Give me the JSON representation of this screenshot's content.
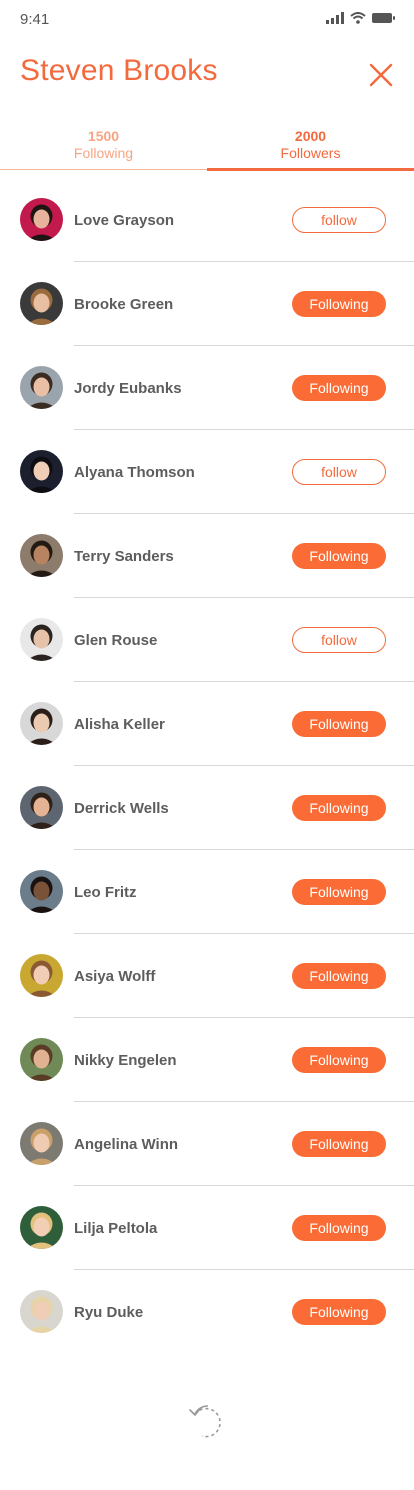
{
  "status_bar": {
    "time": "9:41"
  },
  "header": {
    "title": "Steven Brooks"
  },
  "tabs": {
    "following": {
      "count": "1500",
      "label": "Following"
    },
    "followers": {
      "count": "2000",
      "label": "Followers"
    }
  },
  "colors": {
    "accent": "#f26a3d",
    "button_fill": "#fa6b36",
    "separator": "#d9d9d9"
  },
  "users": [
    {
      "name": "Love Grayson",
      "button": "follow",
      "state": "follow",
      "avatar_bg": "#c21a4c",
      "face": "#e7b39c",
      "hair": "#1e1414"
    },
    {
      "name": "Brooke Green",
      "button": "Following",
      "state": "following",
      "avatar_bg": "#3a3a3a",
      "face": "#e8bfa2",
      "hair": "#9a6b3c"
    },
    {
      "name": "Jordy Eubanks",
      "button": "Following",
      "state": "following",
      "avatar_bg": "#9aa4ad",
      "face": "#e9c0a6",
      "hair": "#3a2c22"
    },
    {
      "name": "Alyana Thomson",
      "button": "follow",
      "state": "follow",
      "avatar_bg": "#1b1f2e",
      "face": "#f0cdb7",
      "hair": "#0e0d12"
    },
    {
      "name": "Terry Sanders",
      "button": "Following",
      "state": "following",
      "avatar_bg": "#8d7c6c",
      "face": "#b88360",
      "hair": "#231a14"
    },
    {
      "name": "Glen Rouse",
      "button": "follow",
      "state": "follow",
      "avatar_bg": "#e8e8e8",
      "face": "#e5c2a8",
      "hair": "#2a2320"
    },
    {
      "name": "Alisha Keller",
      "button": "Following",
      "state": "following",
      "avatar_bg": "#d8d8d8",
      "face": "#eccab2",
      "hair": "#2b1d17"
    },
    {
      "name": "Derrick Wells",
      "button": "Following",
      "state": "following",
      "avatar_bg": "#5d6670",
      "face": "#e3b393",
      "hair": "#2f2119"
    },
    {
      "name": "Leo Fritz",
      "button": "Following",
      "state": "following",
      "avatar_bg": "#6b7c8a",
      "face": "#7a5238",
      "hair": "#1a1210"
    },
    {
      "name": "Asiya Wolff",
      "button": "Following",
      "state": "following",
      "avatar_bg": "#c9a832",
      "face": "#f1cdb6",
      "hair": "#8a5a34"
    },
    {
      "name": "Nikky Engelen",
      "button": "Following",
      "state": "following",
      "avatar_bg": "#6f8a57",
      "face": "#e1b292",
      "hair": "#5a3b25"
    },
    {
      "name": "Angelina Winn",
      "button": "Following",
      "state": "following",
      "avatar_bg": "#7d7a72",
      "face": "#efcbb2",
      "hair": "#c9a06a"
    },
    {
      "name": "Lilja Peltola",
      "button": "Following",
      "state": "following",
      "avatar_bg": "#2f5f3a",
      "face": "#f2cfb4",
      "hair": "#e3c07c"
    },
    {
      "name": "Ryu Duke",
      "button": "Following",
      "state": "following",
      "avatar_bg": "#d9d6d0",
      "face": "#f0cdb6",
      "hair": "#e6d4a6"
    }
  ]
}
